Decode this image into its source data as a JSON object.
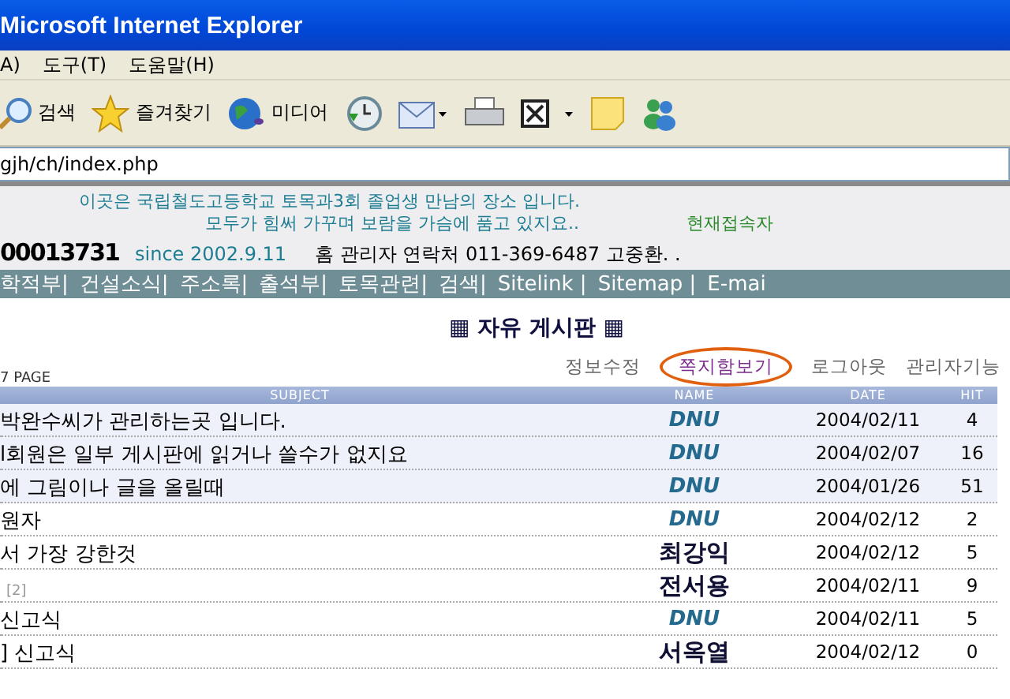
{
  "window": {
    "title": "Microsoft Internet Explorer"
  },
  "menu": [
    "A)",
    "도구(T)",
    "도움말(H)"
  ],
  "toolbar": [
    {
      "kind": "search",
      "label": "검색"
    },
    {
      "kind": "favorites",
      "label": "즐겨찾기"
    },
    {
      "kind": "media",
      "label": "미디어"
    },
    {
      "kind": "history"
    },
    {
      "kind": "mail"
    },
    {
      "kind": "print"
    },
    {
      "kind": "edit"
    },
    {
      "kind": "note"
    },
    {
      "kind": "messenger"
    }
  ],
  "address": {
    "value": "gjh/ch/index.php"
  },
  "header": {
    "welcome": [
      "이곳은 국립철도고등학교 토목과3회 졸업생 만남의 장소 입니다.",
      "모두가 힘써 가꾸며 보람을 가슴에 품고 있지요.."
    ],
    "online": "현재접속자",
    "counter": "00013731",
    "since": "since 2002.9.11",
    "contact": "홈 관리자 연락처 011-369-6487 고중환. ."
  },
  "nav": [
    "학적부|",
    "건설소식|",
    "주소록|",
    "출석부|",
    "토목관련|",
    "검색|",
    "Sitelink |",
    "Sitemap |",
    "E-mai"
  ],
  "board": {
    "title": "▦ 자유 게시판 ▦",
    "page": "7 PAGE",
    "links": [
      {
        "label": "정보수정",
        "circled": false
      },
      {
        "label": "쪽지함보기",
        "circled": true
      },
      {
        "label": "로그아웃",
        "circled": false
      },
      {
        "label": "관리자기능",
        "circled": false
      }
    ],
    "columns": [
      "SUBJECT",
      "NAME",
      "DATE",
      "HIT"
    ],
    "rows": [
      {
        "notice": true,
        "subject": "박완수씨가 관리하는곳 입니다.",
        "name": "DNU",
        "kind": "admin",
        "date": "2004/02/11",
        "hit": "4"
      },
      {
        "notice": true,
        "subject": "l회원은 일부 게시판에 읽거나 쓸수가 없지요",
        "name": "DNU",
        "kind": "admin",
        "date": "2004/02/07",
        "hit": "16"
      },
      {
        "notice": true,
        "subject": "에 그림이나 글을 올릴때",
        "name": "DNU",
        "kind": "admin",
        "date": "2004/01/26",
        "hit": "51"
      },
      {
        "notice": false,
        "subject": "원자",
        "name": "DNU",
        "kind": "admin",
        "date": "2004/02/12",
        "hit": "2"
      },
      {
        "notice": false,
        "subject": "서 가장 강한것",
        "name": "최강익",
        "kind": "member",
        "date": "2004/02/12",
        "hit": "5"
      },
      {
        "notice": false,
        "comments": "[2]",
        "name": "전서용",
        "kind": "member",
        "date": "2004/02/11",
        "hit": "9"
      },
      {
        "notice": false,
        "subject": "신고식",
        "name": "DNU",
        "kind": "admin",
        "date": "2004/02/11",
        "hit": "5"
      },
      {
        "notice": false,
        "subject": "] 신고식",
        "name": "서옥열",
        "kind": "member",
        "date": "2004/02/12",
        "hit": "0"
      }
    ]
  }
}
